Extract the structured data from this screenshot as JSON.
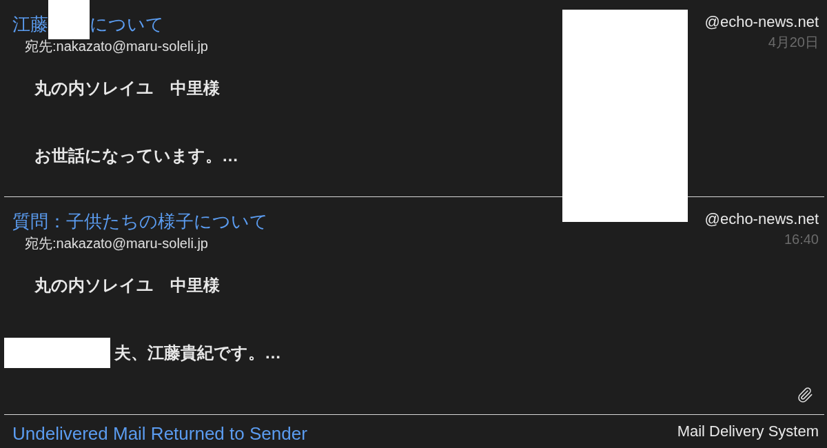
{
  "messages": [
    {
      "subject_start": "江藤",
      "subject_end": "について",
      "sender": "@echo-news.net",
      "date": "4月20日",
      "recipient": "宛先:nakazato@maru-soleli.jp",
      "attachment": false,
      "body": [
        {
          "text": "丸の内ソレイユ　中里様",
          "hidden_start": false
        },
        {
          "text": "お世話になっています。…",
          "hidden_start": false
        }
      ]
    },
    {
      "subject_start": "質問：子供たちの様子について",
      "sender": "@echo-news.net",
      "date": "16:40",
      "recipient": "宛先:nakazato@maru-soleli.jp",
      "attachment": true,
      "body": [
        {
          "text": "丸の内ソレイユ　中里様",
          "hidden_start": false
        },
        {
          "text": "夫、江藤貴紀です。…",
          "hidden_start": true
        }
      ]
    },
    {
      "subject_start": "Undelivered Mail Returned to Sender",
      "sender": "Mail Delivery System"
    }
  ]
}
